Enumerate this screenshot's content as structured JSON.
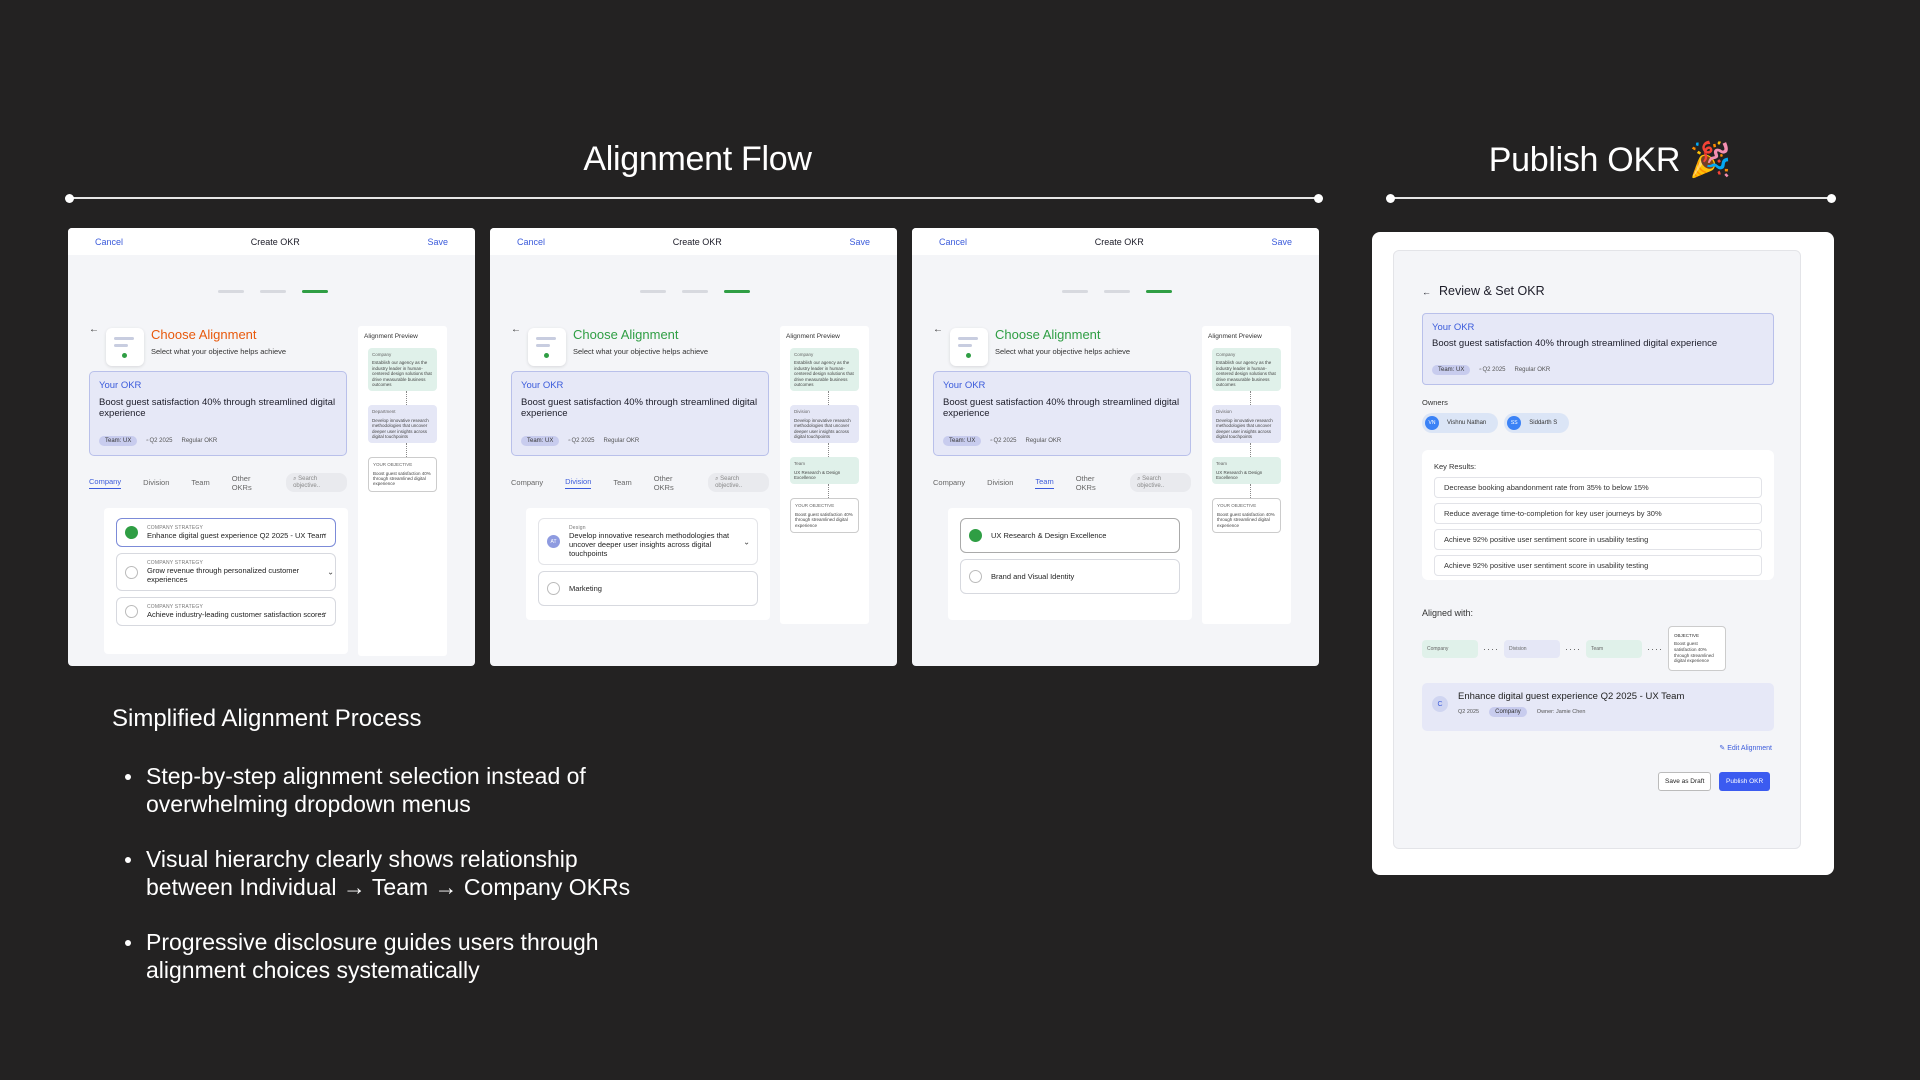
{
  "header": {
    "alignment_title": "Alignment Flow",
    "publish_title": "Publish OKR 🎉"
  },
  "screen": {
    "cancel": "Cancel",
    "title": "Create OKR",
    "save": "Save",
    "choose_title": "Choose Alignment",
    "choose_sub": "Select what your objective helps achieve",
    "okr_label": "Your OKR",
    "okr_text": "Boost guest satisfaction 40% through streamlined digital experience",
    "team_chip": "Team: UX",
    "quarter": "Q2 2025",
    "okr_type": "Regular OKR",
    "tabs": [
      "Company",
      "Division",
      "Team",
      "Other OKRs"
    ],
    "search_placeholder": "Search objective..",
    "preview_title": "Alignment Preview",
    "your_objective_label": "YOUR OBJECTIVE",
    "your_objective_text": "Boost guest satisfaction 40% through streamlined digital experience"
  },
  "screen1": {
    "title_color": "#e8590c",
    "options": [
      {
        "small": "COMPANY STRATEGY",
        "text": "Enhance digital guest experience Q2 2025 - UX Team",
        "selected": true
      },
      {
        "small": "COMPANY STRATEGY",
        "text": "Grow revenue through personalized customer experiences",
        "selected": false
      },
      {
        "small": "COMPANY STRATEGY",
        "text": "Achieve industry-leading customer satisfaction scores",
        "selected": false
      }
    ],
    "preview": [
      {
        "label": "Company",
        "text": "Establish our agency as the industry leader in human-centered design solutions that drive measurable business outcomes"
      },
      {
        "label": "Department",
        "text": "Develop innovative research methodologies that uncover deeper user insights across digital touchpoints"
      }
    ]
  },
  "screen2": {
    "title_color": "#2f9e44",
    "options": [
      {
        "small": "Design",
        "text": "Develop innovative research methodologies that uncover deeper user insights across digital touchpoints",
        "avatar": "AT"
      },
      {
        "small": "",
        "text": "Marketing"
      }
    ],
    "preview": [
      {
        "label": "Company",
        "text": "Establish our agency as the industry leader in human-centered design solutions that drive measurable business outcomes"
      },
      {
        "label": "Division",
        "text": "Develop innovative research methodologies that uncover deeper user insights across digital touchpoints"
      },
      {
        "label": "Team",
        "text": "UX Research & Design Excellence"
      }
    ]
  },
  "screen3": {
    "title_color": "#2f9e44",
    "options": [
      {
        "text": "UX Research & Design Excellence",
        "selected": true
      },
      {
        "text": "Brand and Visual Identity",
        "selected": false
      }
    ]
  },
  "text_block": {
    "heading": "Simplified Alignment Process",
    "bullets": [
      "Step-by-step alignment selection instead of overwhelming dropdown menus",
      "Visual hierarchy clearly shows relationship between Individual → Team → Company OKRs",
      "Progressive disclosure guides users through alignment choices systematically"
    ]
  },
  "review": {
    "title": "Review & Set OKR",
    "okr_label": "Your OKR",
    "okr_text": "Boost guest satisfaction 40% through streamlined digital experience",
    "team_chip": "Team: UX",
    "quarter": "Q2 2025",
    "okr_type": "Regular OKR",
    "owners_label": "Owners",
    "owners": [
      {
        "initials": "VN",
        "name": "Vishnu Nathan"
      },
      {
        "initials": "SS",
        "name": "Siddarth S"
      }
    ],
    "key_results_label": "Key Results:",
    "key_results": [
      "Decrease booking abandonment rate from 35% to below 15%",
      "Reduce average time-to-completion for key user journeys by 30%",
      "Achieve 92% positive user sentiment score in usability testing",
      "Achieve 92% positive user sentiment score in usability testing"
    ],
    "aligned_label": "Aligned with:",
    "chain": [
      "Company",
      "Division",
      "Team"
    ],
    "objective_label": "OBJECTIVE",
    "objective_text": "Boost guest satisfaction 40% through streamlined digital experience",
    "aligned_initial": "C",
    "aligned_title": "Enhance digital guest experience Q2 2025 - UX Team",
    "aligned_quarter": "Q2 2025",
    "aligned_chip": "Company",
    "aligned_owner": "Owner: Jamie Chen",
    "edit_alignment": "Edit Alignment",
    "save_draft": "Save as Draft",
    "publish": "Publish OKR"
  }
}
